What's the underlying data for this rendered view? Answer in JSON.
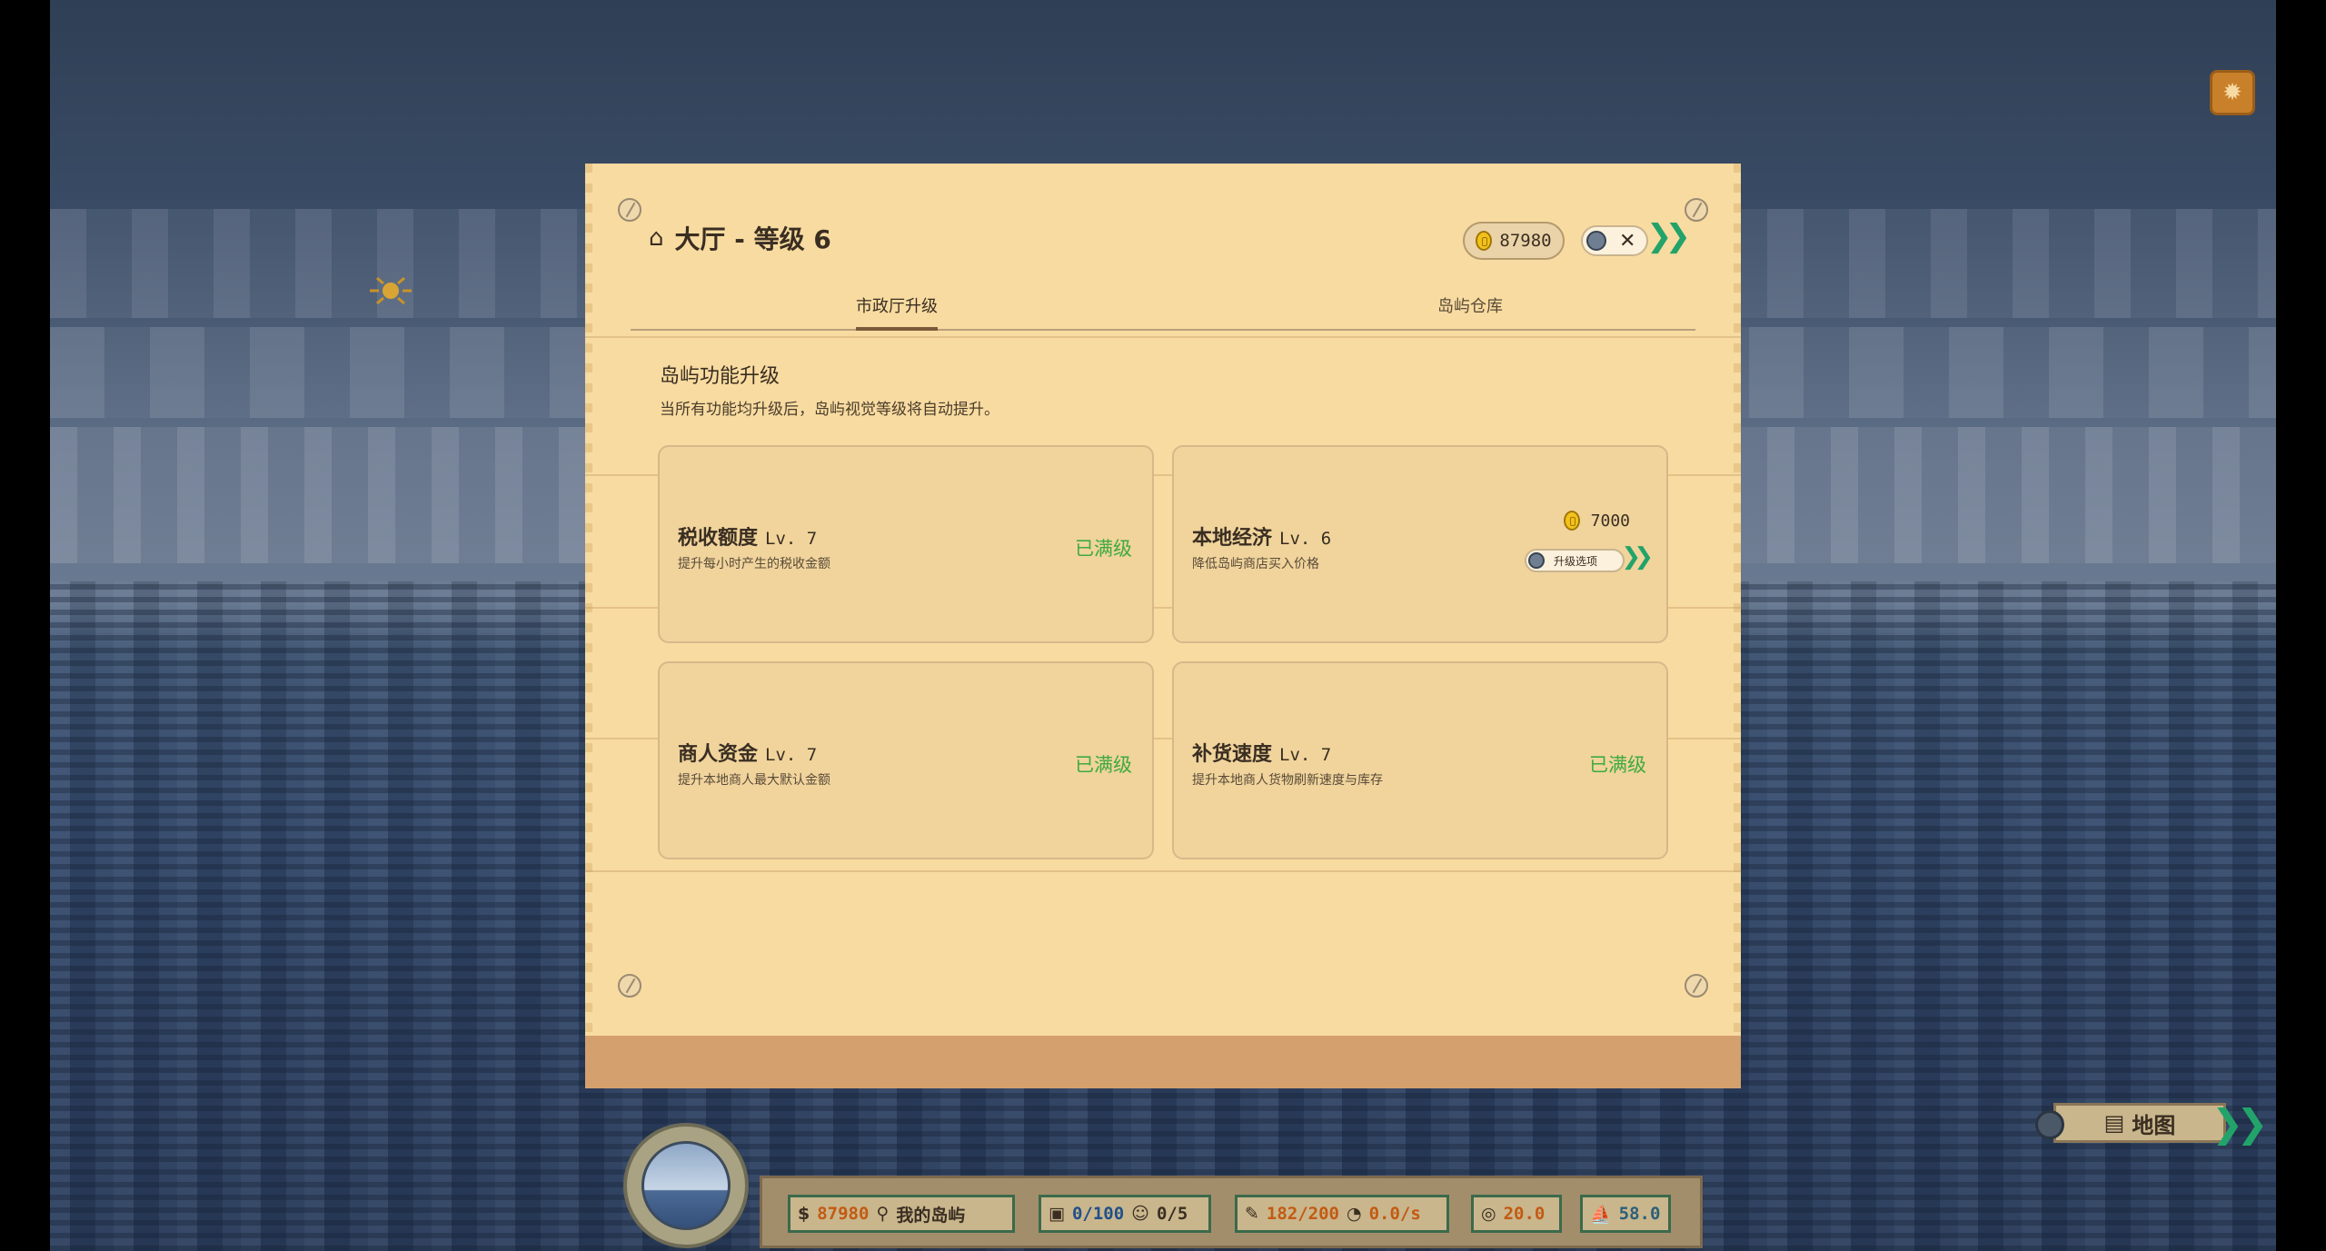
{
  "window": {
    "debug_icon": "bug-icon"
  },
  "modal": {
    "title": "大厅 - 等级 6",
    "title_icon": "home-icon",
    "coins": "87980",
    "close_label": "✕",
    "tabs": [
      {
        "label": "市政厅升级",
        "active": true
      },
      {
        "label": "岛屿仓库",
        "active": false
      }
    ],
    "section_title": "岛屿功能升级",
    "section_desc": "当所有功能均升级后，岛屿视觉等级将自动提升。",
    "cards": [
      {
        "name": "税收额度",
        "level": "Lv. 7",
        "desc": "提升每小时产生的税收金额",
        "status": "已满级"
      },
      {
        "name": "本地经济",
        "level": "Lv. 6",
        "desc": "降低岛屿商店买入价格",
        "price": "7000",
        "upgrade_label": "升级选项"
      },
      {
        "name": "商人资金",
        "level": "Lv. 7",
        "desc": "提升本地商人最大默认金额",
        "status": "已满级"
      },
      {
        "name": "补货速度",
        "level": "Lv. 7",
        "desc": "提升本地商人货物刷新速度与库存",
        "status": "已满级"
      }
    ]
  },
  "hud": {
    "gold": "87980",
    "location": "我的岛屿",
    "cargo": "0/100",
    "crew": "0/5",
    "durability": "182/200",
    "rate": "0.0/s",
    "stat1": "20.0",
    "stat2": "58.0",
    "map_label": "地图"
  },
  "colors": {
    "panel": "#f8dba0",
    "accent_green": "#3faa3f",
    "coin_orange": "#c35a12"
  }
}
